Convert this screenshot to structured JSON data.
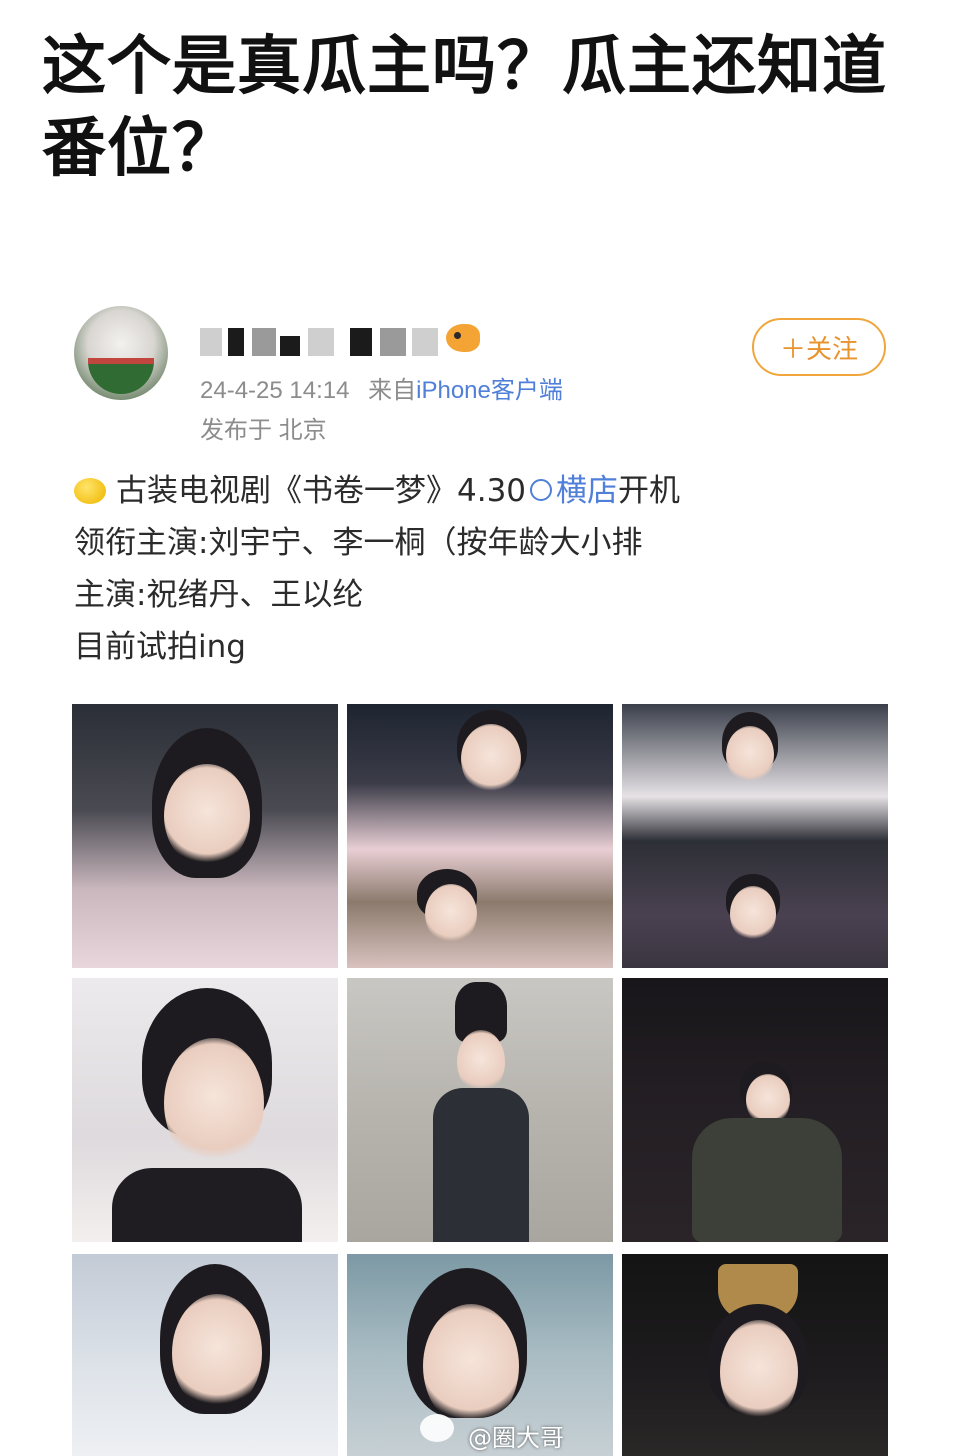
{
  "headline": {
    "line1": "这个是真瓜主吗？瓜主还知道",
    "line2": "番位？"
  },
  "post": {
    "timestamp": "24-4-25 14:14",
    "source": "来自",
    "source_link": "iPhone客户端",
    "location": "发布于 北京",
    "follow_label": "＋关注",
    "text_line1_a": "古装电视剧《书卷一梦》4.30",
    "text_line1_link": "横店",
    "text_line1_b": "开机",
    "text_line2": "领衔主演:刘宇宁、李一桐（按年龄大小排",
    "text_line3": "主演:祝绪丹、王以纶",
    "text_line4": "目前试拍ing"
  },
  "watermark": "@圈大哥",
  "icons": {
    "avatar": "watermelon-avatar",
    "badge": "fish-icon",
    "lemon": "lemon-icon",
    "location": "location-icon",
    "watermark": "weibo-icon"
  },
  "colors": {
    "accent_orange": "#f0a63d",
    "link_blue": "#4f7fd8",
    "meta_gray": "#8c8c8c"
  }
}
